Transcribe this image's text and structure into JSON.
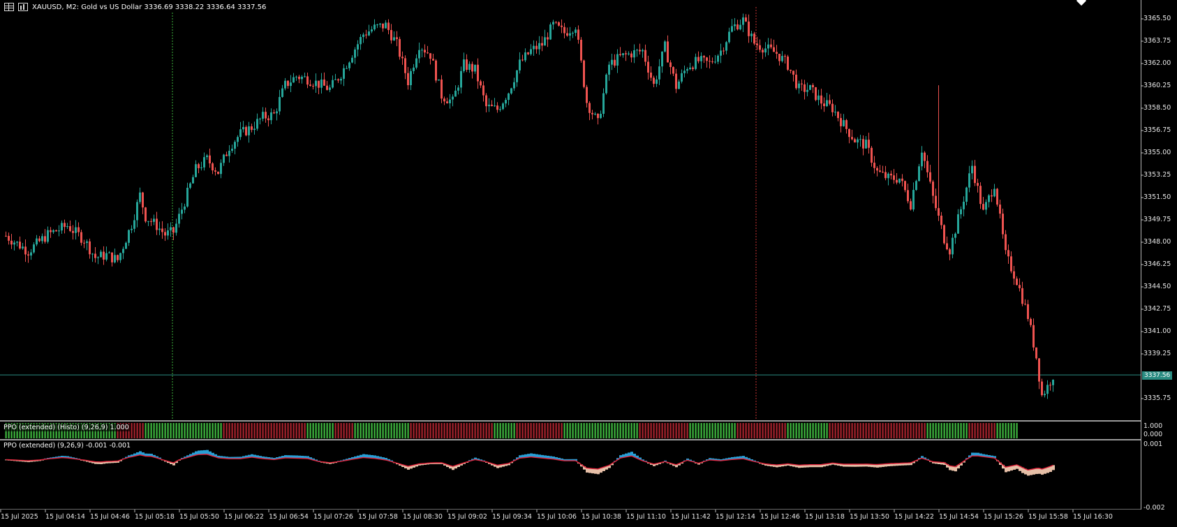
{
  "window": {
    "symbol_line": "XAUUSD, M2:  Gold vs US Dollar  3336.69 3338.22 3336.64 3337.56",
    "icons": [
      "table-icon",
      "chart-bars-icon"
    ]
  },
  "price_axis": {
    "ticks": [
      "3365.50",
      "3363.75",
      "3362.00",
      "3360.25",
      "3358.50",
      "3356.75",
      "3355.00",
      "3353.25",
      "3351.50",
      "3349.75",
      "3348.00",
      "3346.25",
      "3344.50",
      "3342.75",
      "3341.00",
      "3339.25",
      "3337.56",
      "3335.75"
    ],
    "current_price": "3337.56"
  },
  "time_axis": {
    "labels": [
      "15 Jul 2025",
      "15 Jul 04:14",
      "15 Jul 04:46",
      "15 Jul 05:18",
      "15 Jul 05:50",
      "15 Jul 06:22",
      "15 Jul 06:54",
      "15 Jul 07:26",
      "15 Jul 07:58",
      "15 Jul 08:30",
      "15 Jul 09:02",
      "15 Jul 09:34",
      "15 Jul 10:06",
      "15 Jul 10:38",
      "15 Jul 11:10",
      "15 Jul 11:42",
      "15 Jul 12:14",
      "15 Jul 12:46",
      "15 Jul 13:18",
      "15 Jul 13:50",
      "15 Jul 14:22",
      "15 Jul 14:54",
      "15 Jul 15:26",
      "15 Jul 15:58",
      "15 Jul 16:30"
    ]
  },
  "histo_panel": {
    "label": "PPO (extended) (Histo) (9,26,9) 1.000",
    "axis": [
      "1.000",
      "0.000"
    ],
    "color_up": "#3fb83f",
    "color_down": "#a8232d",
    "blocks": [
      [
        "g",
        0,
        17
      ],
      [
        "g",
        17,
        40
      ],
      [
        "r",
        40,
        50
      ],
      [
        "g",
        50,
        78
      ],
      [
        "r",
        78,
        108
      ],
      [
        "g",
        108,
        118
      ],
      [
        "r",
        118,
        125
      ],
      [
        "g",
        125,
        145
      ],
      [
        "r",
        145,
        175
      ],
      [
        "g",
        175,
        183
      ],
      [
        "r",
        183,
        200
      ],
      [
        "g",
        200,
        227
      ],
      [
        "r",
        227,
        245
      ],
      [
        "g",
        245,
        262
      ],
      [
        "r",
        262,
        280
      ],
      [
        "g",
        280,
        295
      ],
      [
        "r",
        295,
        330
      ],
      [
        "g",
        330,
        345
      ],
      [
        "r",
        345,
        355
      ],
      [
        "g",
        355,
        363
      ]
    ]
  },
  "ppo_panel": {
    "label": "PPO (extended) (9,26,9) -0.001 -0.001",
    "axis": [
      "0.001",
      "-0.002"
    ],
    "color_up": "#2aa6e0",
    "color_down": "#f2c9b0",
    "line_color": "#e0223a"
  },
  "colors": {
    "bull": "#26a69a",
    "bear": "#ef5350",
    "vline_green": "#3cb43c",
    "vline_red": "#c83232",
    "current_price_line": "#2a8c82"
  },
  "chart_data": {
    "type": "candlestick",
    "symbol": "XAUUSD",
    "timeframe": "M2",
    "ylim": [
      3334.5,
      3366.5
    ],
    "close_path": [
      [
        0,
        3348.5
      ],
      [
        8,
        3347.3
      ],
      [
        15,
        3348.6
      ],
      [
        22,
        3349.3
      ],
      [
        28,
        3348.2
      ],
      [
        32,
        3346.8
      ],
      [
        36,
        3347.0
      ],
      [
        40,
        3346.6
      ],
      [
        45,
        3349.4
      ],
      [
        48,
        3351.7
      ],
      [
        50,
        3350.0
      ],
      [
        54,
        3349.3
      ],
      [
        57,
        3348.6
      ],
      [
        60,
        3348.8
      ],
      [
        64,
        3351.2
      ],
      [
        68,
        3353.7
      ],
      [
        72,
        3354.5
      ],
      [
        76,
        3353.5
      ],
      [
        80,
        3355.5
      ],
      [
        84,
        3356.5
      ],
      [
        88,
        3357.0
      ],
      [
        92,
        3357.8
      ],
      [
        96,
        3358.0
      ],
      [
        100,
        3360.3
      ],
      [
        104,
        3361.0
      ],
      [
        108,
        3360.8
      ],
      [
        112,
        3360.4
      ],
      [
        116,
        3360.0
      ],
      [
        120,
        3361.2
      ],
      [
        124,
        3362.8
      ],
      [
        128,
        3364.3
      ],
      [
        132,
        3364.8
      ],
      [
        136,
        3365.0
      ],
      [
        140,
        3363.5
      ],
      [
        144,
        3360.6
      ],
      [
        148,
        3363.5
      ],
      [
        152,
        3362.7
      ],
      [
        156,
        3359.5
      ],
      [
        160,
        3359.0
      ],
      [
        164,
        3361.9
      ],
      [
        168,
        3361.5
      ],
      [
        172,
        3358.6
      ],
      [
        176,
        3358.4
      ],
      [
        180,
        3359.8
      ],
      [
        184,
        3362.0
      ],
      [
        188,
        3363.0
      ],
      [
        192,
        3363.5
      ],
      [
        196,
        3365.0
      ],
      [
        200,
        3364.4
      ],
      [
        204,
        3365.0
      ],
      [
        208,
        3359.0
      ],
      [
        212,
        3357.3
      ],
      [
        216,
        3361.9
      ],
      [
        220,
        3362.5
      ],
      [
        224,
        3362.8
      ],
      [
        228,
        3363.0
      ],
      [
        232,
        3360.3
      ],
      [
        236,
        3363.3
      ],
      [
        240,
        3360.2
      ],
      [
        244,
        3361.8
      ],
      [
        248,
        3362.2
      ],
      [
        252,
        3362.0
      ],
      [
        256,
        3363.0
      ],
      [
        260,
        3364.8
      ],
      [
        264,
        3365.4
      ],
      [
        268,
        3363.6
      ],
      [
        272,
        3363.2
      ],
      [
        276,
        3362.8
      ],
      [
        280,
        3361.9
      ],
      [
        284,
        3360.0
      ],
      [
        288,
        3360.0
      ],
      [
        292,
        3359.0
      ],
      [
        296,
        3358.5
      ],
      [
        300,
        3357.2
      ],
      [
        304,
        3356.0
      ],
      [
        308,
        3355.6
      ],
      [
        312,
        3353.5
      ],
      [
        316,
        3353.0
      ],
      [
        320,
        3353.0
      ],
      [
        324,
        3351.0
      ],
      [
        328,
        3355.3
      ],
      [
        332,
        3351.5
      ],
      [
        336,
        3348.3
      ],
      [
        338,
        3347.4
      ],
      [
        342,
        3350.6
      ],
      [
        346,
        3354.0
      ],
      [
        350,
        3350.3
      ],
      [
        354,
        3352.6
      ],
      [
        358,
        3347.0
      ],
      [
        362,
        3345.0
      ],
      [
        366,
        3342.2
      ],
      [
        369,
        3339.0
      ],
      [
        371,
        3336.0
      ],
      [
        373,
        3336.7
      ],
      [
        375,
        3337.6
      ]
    ],
    "markers": {
      "vertical_lines": [
        {
          "time": "15 Jul 05:50",
          "style": "dotted green"
        },
        {
          "time": "15 Jul 13:18",
          "style": "dotted red"
        }
      ]
    }
  }
}
